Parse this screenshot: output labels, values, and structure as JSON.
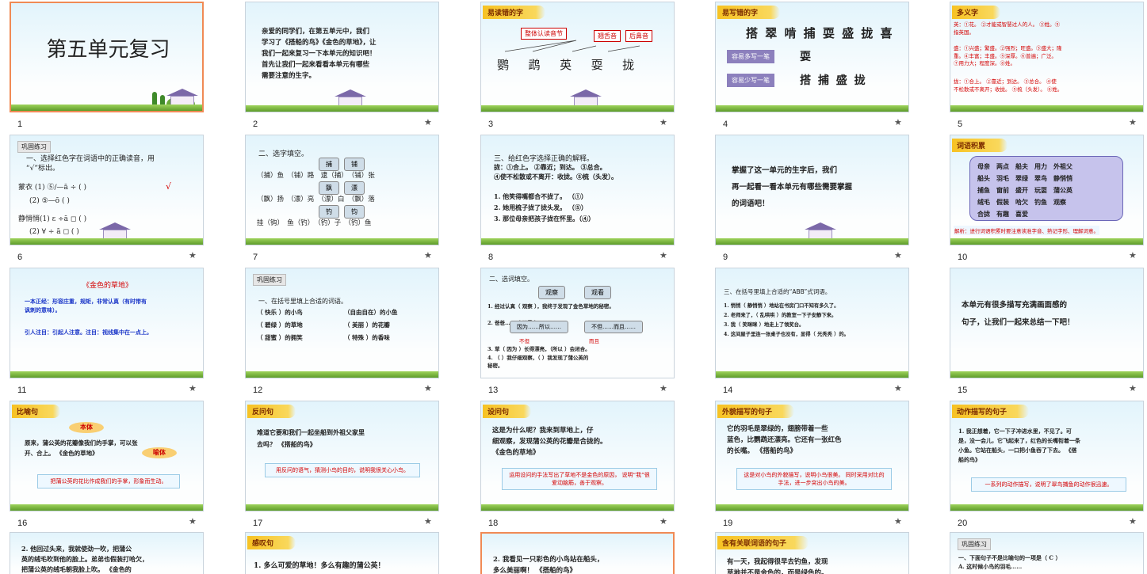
{
  "slides": [
    {
      "n": "1",
      "l": "",
      "star": "",
      "title": "第五单元复习"
    },
    {
      "n": "2",
      "l": "",
      "star": "★",
      "b1": "亲爱的同学们，在第五单元中，我们\n学习了《搭船的鸟》《金色的草地》，让\n我们一起来复习一下本单元的知识吧！\n    首先让我们一起来看看本单元有哪些\n需要注意的生字。"
    },
    {
      "n": "3",
      "l": "易读错的字",
      "star": "★",
      "k1": "整体认读音节",
      "k2": "翘舌音",
      "k3": "后鼻音",
      "chars": "鹦　  鹉　  英　  耍　  拢"
    },
    {
      "n": "4",
      "l": "易写错的字",
      "star": "★",
      "row1": "搭 翠 啃 捕 耍 盛 拢 喜",
      "lab1": "容易多写一笔",
      "c1": "耍",
      "lab2": "容易少写一笔",
      "c2": "搭 捕 盛 拢"
    },
    {
      "n": "5",
      "l": "多义字",
      "star": "★",
      "p1": "英：①花。 ②才能或智慧过人的人。 ③姓。⑤\n指英国。",
      "p2": "盛：①兴盛；繁盛。②强烈；旺盛。③盛大；隆\n重。④丰富；丰盛。⑤深厚。⑥普遍；广泛。\n⑦用力大；程度深。⑧姓。",
      "p3": "拢：①合上。 ②靠近；到达。 ③总合。 ④使\n不松散或不离开；收拢。 ⑤梳（头发）。 ⑥姓。"
    },
    {
      "n": "6",
      "l": "",
      "star": "★",
      "sect": "巩固练习",
      "b1": "一、选择红色字在词语中的正确读音，用\n“√”标出。",
      "q1": "蒙衣  (1) ⑤∕—ā ÷ (     )",
      "q2": "(2) ⑤—ō (    )",
      "q3": "静悄悄(1) ɛ ÷ā ◻ (    )",
      "q4": "(2) ∀ ÷ ā ◻ (    )",
      "check": "√"
    },
    {
      "n": "7",
      "l": "",
      "star": "★",
      "b1": "二、选字填空。",
      "opts": [
        "捕",
        "铺",
        "飘",
        "漂",
        "钓",
        "钧"
      ],
      "r1": "（捕）鱼　（铺）路　逮（捕）　（铺）张",
      "r2": "（飘）扬　（漂）亮　（漂）白　（飘）落",
      "r3": "挂（钩）　鱼（钓）　（钓）子　（钓）鱼"
    },
    {
      "n": "8",
      "l": "",
      "star": "★",
      "b1": "三、给红色字选择正确的解释。",
      "def": "拢：①合上。 ②靠近；到达。 ③总合。\n④使不松散或不离开：收拢。⑤梳（头发）。",
      "s1": "1. 他笑得嘴都合不拢了。   （①）",
      "s2": "2. 她用梳子拢了拢头发。   （⑤）",
      "s3": "3. 那位母亲把孩子拢在怀里。（④）"
    },
    {
      "n": "9",
      "l": "",
      "star": "★",
      "b1": "    掌握了这一单元的生字后，我们\n再一起看一看本单元有哪些需要掌握\n的词语吧！"
    },
    {
      "n": "10",
      "l": "词语积累",
      "star": "★",
      "words": "母亲　两点　船夫　用力　外祖父\n船头　羽毛　翠绿　翠鸟　静悄悄\n捕鱼　窗前　盛开　玩耍　蒲公英\n绒毛　假装　哈欠　钓鱼　观察\n合拢　有趣　喜爱",
      "tip": "解析：进行词语积累时要注意读准字音、熟记字形、理解词意。"
    },
    {
      "n": "11",
      "l": "",
      "star": "★",
      "head": "《金色的草地》",
      "d1": "一本正经：形容庄重，规矩，非常认真（有时带有\n讽刺的意味）。",
      "d2": "引人注目：引起人注意。注目：视线集中在一点上。"
    },
    {
      "n": "12",
      "l": "",
      "star": "★",
      "sect": "巩固练习",
      "b1": "一、在括号里填上合适的词语。",
      "a1": "（ 快乐 ）的小鸟",
      "a2": "（自由自在）的小鱼",
      "a3": "（ 碧绿 ）的草地",
      "a4": "（ 美丽 ）的花瓣",
      "a5": "（ 甜蜜 ）的拥笑",
      "a6": "（ 特殊 ）的香味"
    },
    {
      "n": "13",
      "l": "",
      "star": "★",
      "b1": "二、选词填空。",
      "w1": "观察",
      "w2": "观看",
      "w3": "因为……所以……",
      "w4": "不但……而且……",
      "q1": "1. 经过认真（ 观察 ），我终于发现了金色草地的秘密。",
      "q2": "2. 爸爸……（ 观看 ）",
      "q3": "3. 草（ 因为 ）长得漂亮，（所以 ）会闭合。",
      "q4": "4. （    ）我仔细观察，（    ）我发现了蒲公英的\n秘密。",
      "m1": "不但",
      "m2": "而且"
    },
    {
      "n": "14",
      "l": "",
      "star": "★",
      "b1": "三、在括号里填上合适的“ABB”式词语。",
      "q1": "1. 悄悄（ 静悄悄 ）地站在书房门口不知有多久了。",
      "q2": "2. 老师来了，（ 乱哄哄 ）的教室一下子安静下来。",
      "q3": "3. 我（ 笑眯眯 ）地走上了领奖台。",
      "q4": "4. 这间屋子里连一张桌子也没有，显得（ 光秃秃 ）的。"
    },
    {
      "n": "15",
      "l": "",
      "star": "★",
      "b1": "    本单元有很多描写充满画面感的\n句子，让我们一起来总结一下吧！"
    },
    {
      "n": "16",
      "l": "比喻句",
      "star": "★",
      "o1": "本体",
      "o2": "喻体",
      "b1": "    原来，蒲公英的花瓣像我们的手掌，可以张\n开、合上。 《金色的草地》",
      "note": "把蒲公英的花比作成我们的手掌，形象而生动。"
    },
    {
      "n": "17",
      "l": "反问句",
      "star": "★",
      "b1": "    难道它要和我们一起坐船到外祖父家里\n去吗？ 《搭船的鸟》",
      "note": "用反问的语气，猜测小鸟的目的，说明我很关心小鸟。"
    },
    {
      "n": "18",
      "l": "设问句",
      "star": "★",
      "b1": "    这是为什么呢？我来到草地上，仔\n细观察，发现蒲公英的花瓣是合拢的。\n《金色的草地》",
      "note": "运用设问的手法写出了草地不是金色的原因，\n说明“我”很爱动脑筋，善于观察。"
    },
    {
      "n": "19",
      "l": "外貌描写的句子",
      "star": "★",
      "b1": "    它的羽毛是翠绿的，翅膀带着一些\n蓝色，比鹦鹉还漂亮。它还有一张红色\n的长嘴。 《搭船的鸟》",
      "note": "这是对小鸟的外貌描写，说明小鸟很美。\n同时采用对比的手法，进一步突出小鸟的美。"
    },
    {
      "n": "20",
      "l": "动作描写的句子",
      "star": "★",
      "b1": "    1. 我正想着，它一下子冲进水里，不见了。可\n是，没一会儿，它飞起来了，红色的长嘴衔着一条\n小鱼。它站在船头，一口把小鱼吞了下去。 《搭\n船的鸟》",
      "note": "一系列的动作描写，说明了翠鸟捕鱼的动作很迅速。"
    },
    {
      "n": "21",
      "l": "",
      "star": "",
      "b1": "    2. 他回过头来，我就使劲一吹，把蒲公\n英的绒毛吹到他的脸上。弟弟也假装打哈欠，\n把蒲公英的绒毛朝我脸上吹。 《金色的"
    },
    {
      "n": "22",
      "l": "感叹句",
      "star": "",
      "b1": "1. 多么可爱的草地！多么有趣的蒲公英！"
    },
    {
      "n": "23",
      "l": "",
      "star": "",
      "b1": "    2. 我看见一只彩色的小鸟站在船头，\n多么美丽啊！ 《搭船的鸟》"
    },
    {
      "n": "24",
      "l": "含有关联词语的句子",
      "star": "",
      "b1": "    有一天，我起得很早去钓鱼，发现\n草地并不是金色的，而是绿色的。"
    },
    {
      "n": "25",
      "l": "",
      "star": "",
      "sect": "巩固练习",
      "b1": "一、下面句子不是比喻句的一项是（ C ）\nA. 这时候小鸟的羽毛……"
    }
  ]
}
